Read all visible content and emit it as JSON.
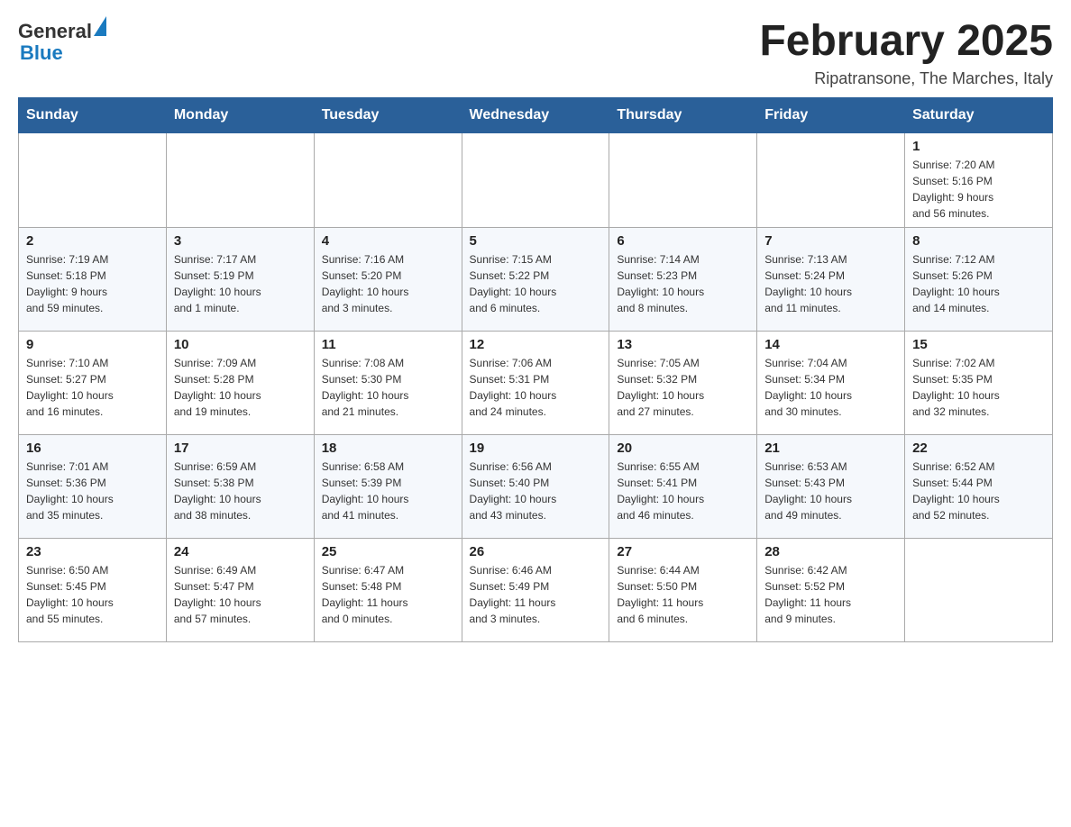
{
  "header": {
    "logo_text_general": "General",
    "logo_text_blue": "Blue",
    "month_title": "February 2025",
    "location": "Ripatransone, The Marches, Italy"
  },
  "days_of_week": [
    "Sunday",
    "Monday",
    "Tuesday",
    "Wednesday",
    "Thursday",
    "Friday",
    "Saturday"
  ],
  "weeks": [
    {
      "days": [
        {
          "num": "",
          "info": ""
        },
        {
          "num": "",
          "info": ""
        },
        {
          "num": "",
          "info": ""
        },
        {
          "num": "",
          "info": ""
        },
        {
          "num": "",
          "info": ""
        },
        {
          "num": "",
          "info": ""
        },
        {
          "num": "1",
          "info": "Sunrise: 7:20 AM\nSunset: 5:16 PM\nDaylight: 9 hours\nand 56 minutes."
        }
      ]
    },
    {
      "days": [
        {
          "num": "2",
          "info": "Sunrise: 7:19 AM\nSunset: 5:18 PM\nDaylight: 9 hours\nand 59 minutes."
        },
        {
          "num": "3",
          "info": "Sunrise: 7:17 AM\nSunset: 5:19 PM\nDaylight: 10 hours\nand 1 minute."
        },
        {
          "num": "4",
          "info": "Sunrise: 7:16 AM\nSunset: 5:20 PM\nDaylight: 10 hours\nand 3 minutes."
        },
        {
          "num": "5",
          "info": "Sunrise: 7:15 AM\nSunset: 5:22 PM\nDaylight: 10 hours\nand 6 minutes."
        },
        {
          "num": "6",
          "info": "Sunrise: 7:14 AM\nSunset: 5:23 PM\nDaylight: 10 hours\nand 8 minutes."
        },
        {
          "num": "7",
          "info": "Sunrise: 7:13 AM\nSunset: 5:24 PM\nDaylight: 10 hours\nand 11 minutes."
        },
        {
          "num": "8",
          "info": "Sunrise: 7:12 AM\nSunset: 5:26 PM\nDaylight: 10 hours\nand 14 minutes."
        }
      ]
    },
    {
      "days": [
        {
          "num": "9",
          "info": "Sunrise: 7:10 AM\nSunset: 5:27 PM\nDaylight: 10 hours\nand 16 minutes."
        },
        {
          "num": "10",
          "info": "Sunrise: 7:09 AM\nSunset: 5:28 PM\nDaylight: 10 hours\nand 19 minutes."
        },
        {
          "num": "11",
          "info": "Sunrise: 7:08 AM\nSunset: 5:30 PM\nDaylight: 10 hours\nand 21 minutes."
        },
        {
          "num": "12",
          "info": "Sunrise: 7:06 AM\nSunset: 5:31 PM\nDaylight: 10 hours\nand 24 minutes."
        },
        {
          "num": "13",
          "info": "Sunrise: 7:05 AM\nSunset: 5:32 PM\nDaylight: 10 hours\nand 27 minutes."
        },
        {
          "num": "14",
          "info": "Sunrise: 7:04 AM\nSunset: 5:34 PM\nDaylight: 10 hours\nand 30 minutes."
        },
        {
          "num": "15",
          "info": "Sunrise: 7:02 AM\nSunset: 5:35 PM\nDaylight: 10 hours\nand 32 minutes."
        }
      ]
    },
    {
      "days": [
        {
          "num": "16",
          "info": "Sunrise: 7:01 AM\nSunset: 5:36 PM\nDaylight: 10 hours\nand 35 minutes."
        },
        {
          "num": "17",
          "info": "Sunrise: 6:59 AM\nSunset: 5:38 PM\nDaylight: 10 hours\nand 38 minutes."
        },
        {
          "num": "18",
          "info": "Sunrise: 6:58 AM\nSunset: 5:39 PM\nDaylight: 10 hours\nand 41 minutes."
        },
        {
          "num": "19",
          "info": "Sunrise: 6:56 AM\nSunset: 5:40 PM\nDaylight: 10 hours\nand 43 minutes."
        },
        {
          "num": "20",
          "info": "Sunrise: 6:55 AM\nSunset: 5:41 PM\nDaylight: 10 hours\nand 46 minutes."
        },
        {
          "num": "21",
          "info": "Sunrise: 6:53 AM\nSunset: 5:43 PM\nDaylight: 10 hours\nand 49 minutes."
        },
        {
          "num": "22",
          "info": "Sunrise: 6:52 AM\nSunset: 5:44 PM\nDaylight: 10 hours\nand 52 minutes."
        }
      ]
    },
    {
      "days": [
        {
          "num": "23",
          "info": "Sunrise: 6:50 AM\nSunset: 5:45 PM\nDaylight: 10 hours\nand 55 minutes."
        },
        {
          "num": "24",
          "info": "Sunrise: 6:49 AM\nSunset: 5:47 PM\nDaylight: 10 hours\nand 57 minutes."
        },
        {
          "num": "25",
          "info": "Sunrise: 6:47 AM\nSunset: 5:48 PM\nDaylight: 11 hours\nand 0 minutes."
        },
        {
          "num": "26",
          "info": "Sunrise: 6:46 AM\nSunset: 5:49 PM\nDaylight: 11 hours\nand 3 minutes."
        },
        {
          "num": "27",
          "info": "Sunrise: 6:44 AM\nSunset: 5:50 PM\nDaylight: 11 hours\nand 6 minutes."
        },
        {
          "num": "28",
          "info": "Sunrise: 6:42 AM\nSunset: 5:52 PM\nDaylight: 11 hours\nand 9 minutes."
        },
        {
          "num": "",
          "info": ""
        }
      ]
    }
  ]
}
